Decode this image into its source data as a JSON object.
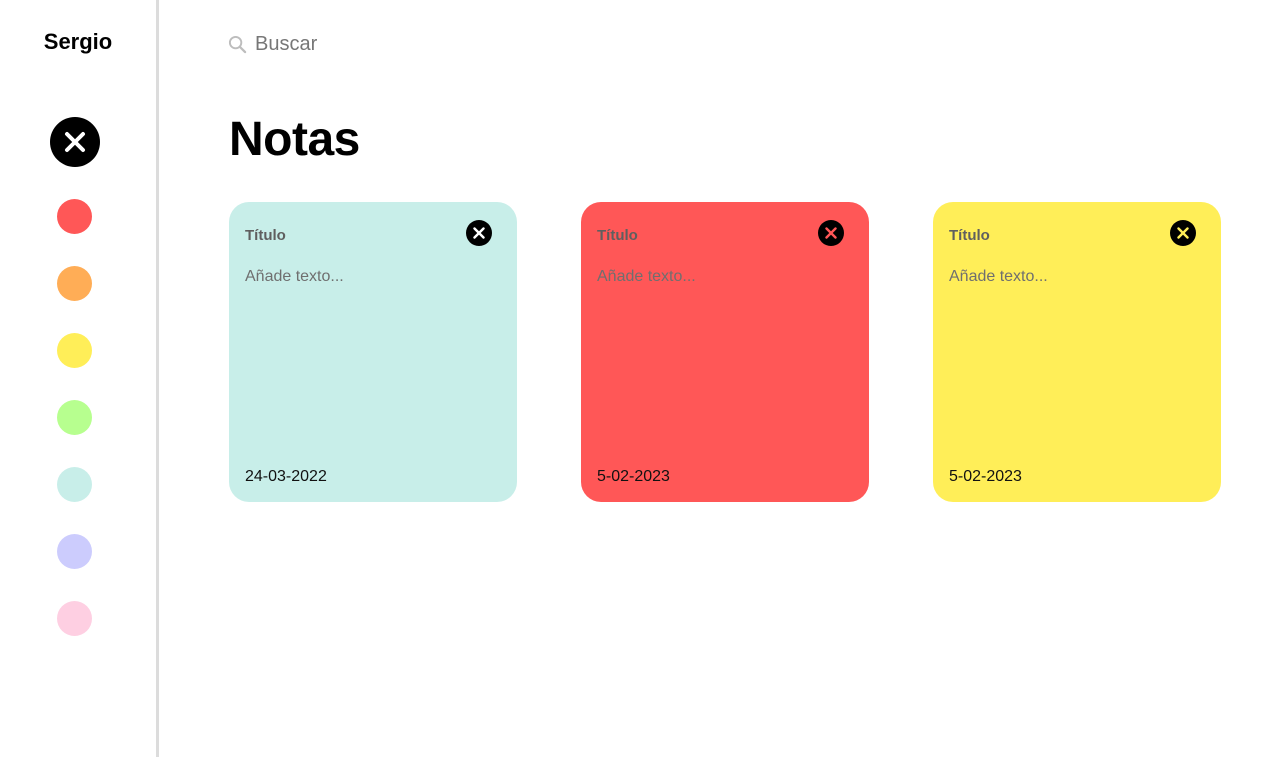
{
  "sidebar": {
    "user_name": "Sergio",
    "close_icon": "close-icon",
    "palette": [
      {
        "name": "red",
        "color": "#ff5757"
      },
      {
        "name": "orange",
        "color": "#ffad56"
      },
      {
        "name": "yellow",
        "color": "#ffee58"
      },
      {
        "name": "green",
        "color": "#b7ff8f"
      },
      {
        "name": "mint",
        "color": "#c8eee9"
      },
      {
        "name": "lavender",
        "color": "#ccccfd"
      },
      {
        "name": "pink",
        "color": "#fecfe2"
      }
    ]
  },
  "search": {
    "placeholder": "Buscar",
    "icon": "search-icon"
  },
  "page": {
    "title": "Notas"
  },
  "notes": [
    {
      "title": "Título",
      "placeholder": "Añade texto...",
      "date": "24-03-2022",
      "color": "#c8eee9",
      "close_icon_color": "#ffffff"
    },
    {
      "title": "Título",
      "placeholder": "Añade texto...",
      "date": "5-02-2023",
      "color": "#ff5757",
      "close_icon_color": "#ff5757"
    },
    {
      "title": "Título",
      "placeholder": "Añade texto...",
      "date": "5-02-2023",
      "color": "#ffee58",
      "close_icon_color": "#ffee58"
    }
  ]
}
